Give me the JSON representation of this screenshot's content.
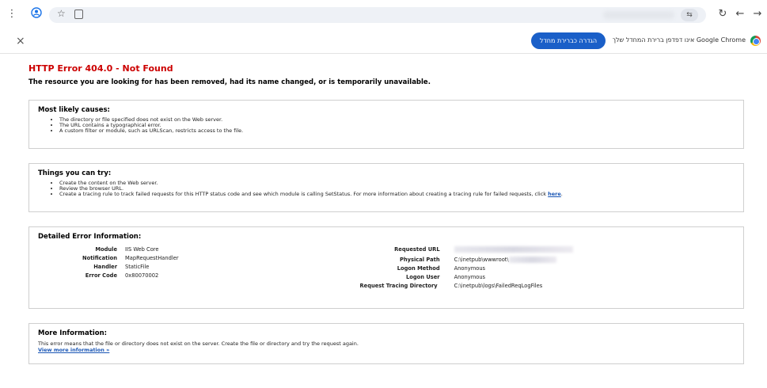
{
  "toolbar": {
    "menu_icon": "⋮",
    "nav_back": "←",
    "nav_forward": "→",
    "reload": "↻",
    "tune_icon": "⇆"
  },
  "infobar": {
    "close": "×",
    "default_button": "הגדרה כברירת מחדל",
    "message": "Google Chrome אינו דפדפן ברירת המחדל שלך"
  },
  "page": {
    "title": "HTTP Error 404.0 - Not Found",
    "subtitle": "The resource you are looking for has been removed, had its name changed, or is temporarily unavailable.",
    "causes": {
      "heading": "Most likely causes:",
      "items": [
        "The directory or file specified does not exist on the Web server.",
        "The URL contains a typographical error.",
        "A custom filter or module, such as URLScan, restricts access to the file."
      ]
    },
    "try": {
      "heading": "Things you can try:",
      "items": [
        "Create the content on the Web server.",
        "Review the browser URL.",
        "Create a tracing rule to track failed requests for this HTTP status code and see which module is calling SetStatus. For more information about creating a tracing rule for failed requests, click "
      ],
      "here_link": "here"
    },
    "details": {
      "heading": "Detailed Error Information:",
      "left": [
        {
          "k": "Module",
          "v": "IIS Web Core"
        },
        {
          "k": "Notification",
          "v": "MapRequestHandler"
        },
        {
          "k": "Handler",
          "v": "StaticFile"
        },
        {
          "k": "Error Code",
          "v": "0x80070002"
        }
      ],
      "right": {
        "requested_url_label": "Requested URL",
        "physical_path_label": "Physical Path",
        "physical_path_value": "C:\\inetpub\\wwwroot\\",
        "logon_method_label": "Logon Method",
        "logon_method_value": "Anonymous",
        "logon_user_label": "Logon User",
        "logon_user_value": "Anonymous",
        "tracing_label": "Request Tracing Directory",
        "tracing_value": "C:\\inetpub\\logs\\FailedReqLogFiles"
      }
    },
    "more": {
      "heading": "More Information:",
      "text": "This error means that the file or directory does not exist on the server. Create the file or directory and try the request again.",
      "link": "View more information »"
    }
  }
}
